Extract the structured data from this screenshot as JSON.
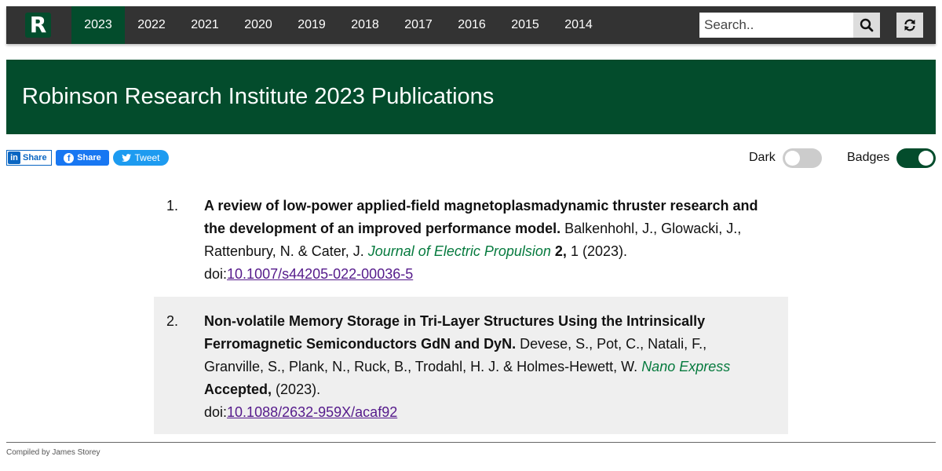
{
  "nav": {
    "logo_letter": "R",
    "years": [
      "2023",
      "2022",
      "2021",
      "2020",
      "2019",
      "2018",
      "2017",
      "2016",
      "2015",
      "2014"
    ],
    "active_year": "2023",
    "search_placeholder": "Search.."
  },
  "banner": {
    "title": "Robinson Research Institute 2023 Publications"
  },
  "share": {
    "linkedin_mark": "in",
    "linkedin": "Share",
    "facebook_mark": "f",
    "facebook": "Share",
    "twitter": "Tweet"
  },
  "toggles": {
    "dark_label": "Dark",
    "dark_on": false,
    "badges_label": "Badges",
    "badges_on": true
  },
  "publications": [
    {
      "number": "1.",
      "title": "A review of low-power applied-field magnetoplasmadynamic thruster research and the development of an improved performance model.",
      "authors": "Balkenhohl, J., Glowacki, J., Rattenbury, N. & Cater, J.",
      "journal": "Journal of Electric Propulsion",
      "volume": "2,",
      "rest": "1 (2023).",
      "doi_prefix": "doi:",
      "doi": "10.1007/s44205-022-00036-5"
    },
    {
      "number": "2.",
      "title": "Non-volatile Memory Storage in Tri-Layer Structures Using the Intrinsically Ferromagnetic Semiconductors GdN and DyN.",
      "authors": "Devese, S., Pot, C., Natali, F., Granville, S., Plank, N., Ruck, B., Trodahl, H. J. & Holmes-Hewett, W.",
      "journal": "Nano Express",
      "volume": "Accepted,",
      "rest": "(2023).",
      "doi_prefix": "doi:",
      "doi": "10.1088/2632-959X/acaf92"
    }
  ],
  "footer": {
    "text": "Compiled by James Storey"
  },
  "colors": {
    "brand_green": "#034c2c",
    "nav_background": "#333333",
    "journal_green": "#067a3e",
    "link_purple": "#551a8b"
  }
}
